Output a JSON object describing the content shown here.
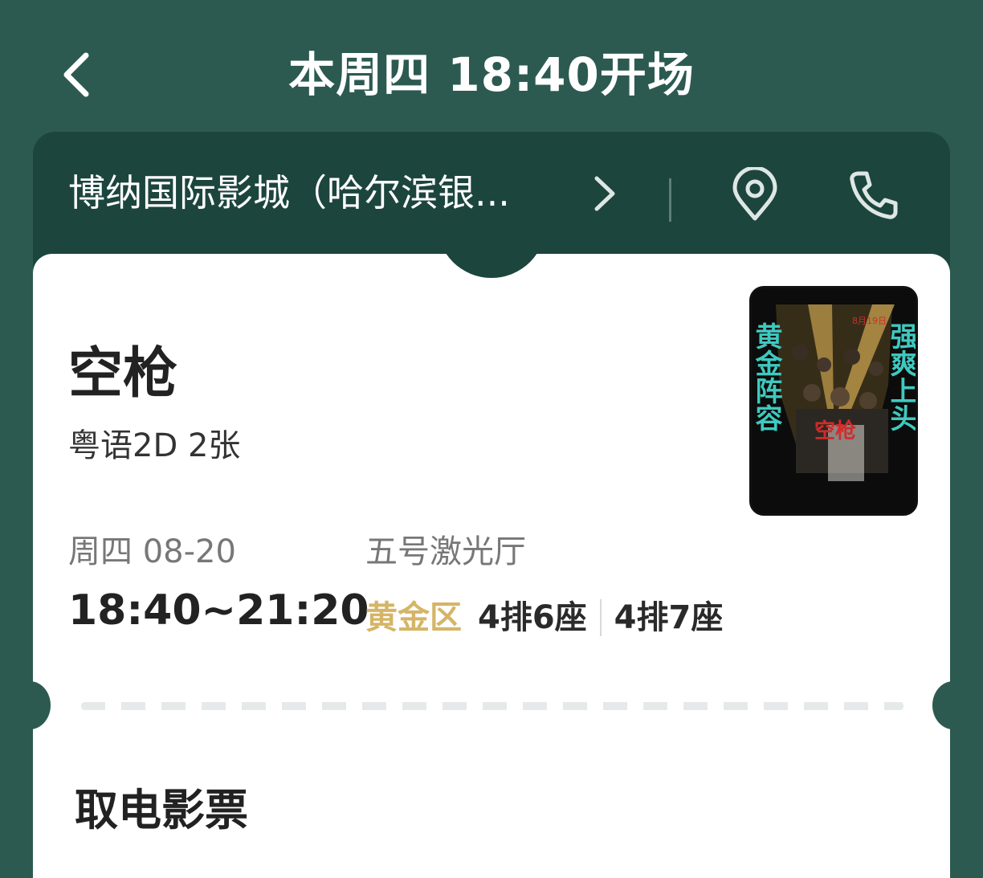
{
  "header": {
    "title": "本周四 18:40开场",
    "back_icon": "chevron-left-icon"
  },
  "cinema": {
    "name": "博纳国际影城（哈尔滨银...",
    "chevron_icon": "chevron-right-icon",
    "location_icon": "location-pin-icon",
    "phone_icon": "phone-icon"
  },
  "movie": {
    "title": "空枪",
    "format": "粤语2D 2张",
    "poster": {
      "left_text": "黄金阵容",
      "right_text": "强爽上头",
      "center_text": "空枪",
      "top_text": "8月19日"
    }
  },
  "show": {
    "date": "周四 08-20",
    "time": "18:40~21:20",
    "hall": "五号激光厅"
  },
  "seats": {
    "zone": "黄金区",
    "list": [
      "4排6座",
      "4排7座"
    ]
  },
  "pickup": {
    "title": "取电影票"
  },
  "colors": {
    "background": "#2c5a51",
    "cinema_bar": "#1c453d",
    "zone_gold": "#d5b566",
    "poster_teal": "#3fc9c0",
    "poster_red": "#d42a2a"
  }
}
